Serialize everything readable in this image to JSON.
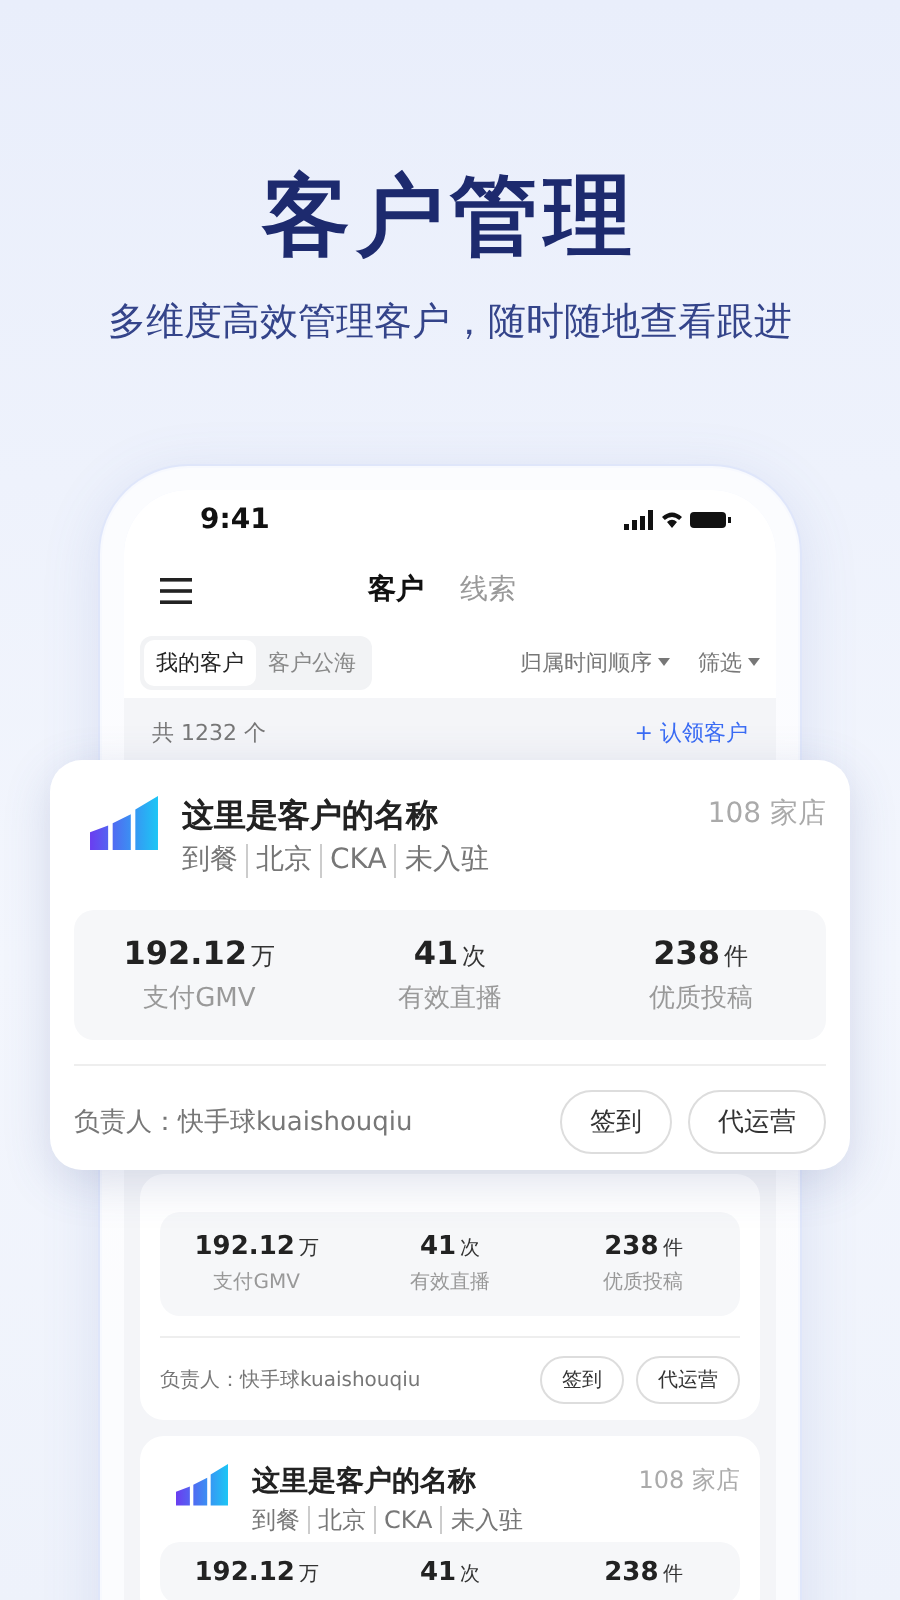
{
  "headline": {
    "title": "客户管理",
    "subtitle": "多维度高效管理客户，随时随地查看跟进"
  },
  "phone": {
    "status_bar": {
      "time": "9:41"
    },
    "tabs": [
      {
        "label": "客户",
        "selected": true
      },
      {
        "label": "线索",
        "selected": false
      }
    ],
    "segments": [
      {
        "label": "我的客户",
        "selected": true
      },
      {
        "label": "客户公海",
        "selected": false
      }
    ],
    "dropdowns": [
      {
        "label": "归属时间顺序"
      },
      {
        "label": "筛选"
      }
    ],
    "summary": {
      "count": "共 1232 个",
      "action": "+ 认领客户"
    },
    "cards": [
      {
        "stats": [
          {
            "value": "192.12",
            "unit": "万",
            "label": "支付GMV"
          },
          {
            "value": "41",
            "unit": "次",
            "label": "有效直播"
          },
          {
            "value": "238",
            "unit": "件",
            "label": "优质投稿"
          }
        ],
        "owner": "负责人：快手球kuaishouqiu",
        "buttons": [
          "签到",
          "代运营"
        ]
      },
      {
        "name": "这里是客户的名称",
        "stores": "108 家店",
        "tags": [
          "到餐",
          "北京",
          "CKA",
          "未入驻"
        ],
        "stats": [
          {
            "value": "192.12",
            "unit": "万"
          },
          {
            "value": "41",
            "unit": "次"
          },
          {
            "value": "238",
            "unit": "件"
          }
        ]
      }
    ]
  },
  "featured_card": {
    "name": "这里是客户的名称",
    "stores": "108 家店",
    "tags": [
      "到餐",
      "北京",
      "CKA",
      "未入驻"
    ],
    "stats": [
      {
        "value": "192.12",
        "unit": "万",
        "label": "支付GMV"
      },
      {
        "value": "41",
        "unit": "次",
        "label": "有效直播"
      },
      {
        "value": "238",
        "unit": "件",
        "label": "优质投稿"
      }
    ],
    "owner": "负责人：快手球kuaishouqiu",
    "buttons": [
      "签到",
      "代运营"
    ]
  }
}
